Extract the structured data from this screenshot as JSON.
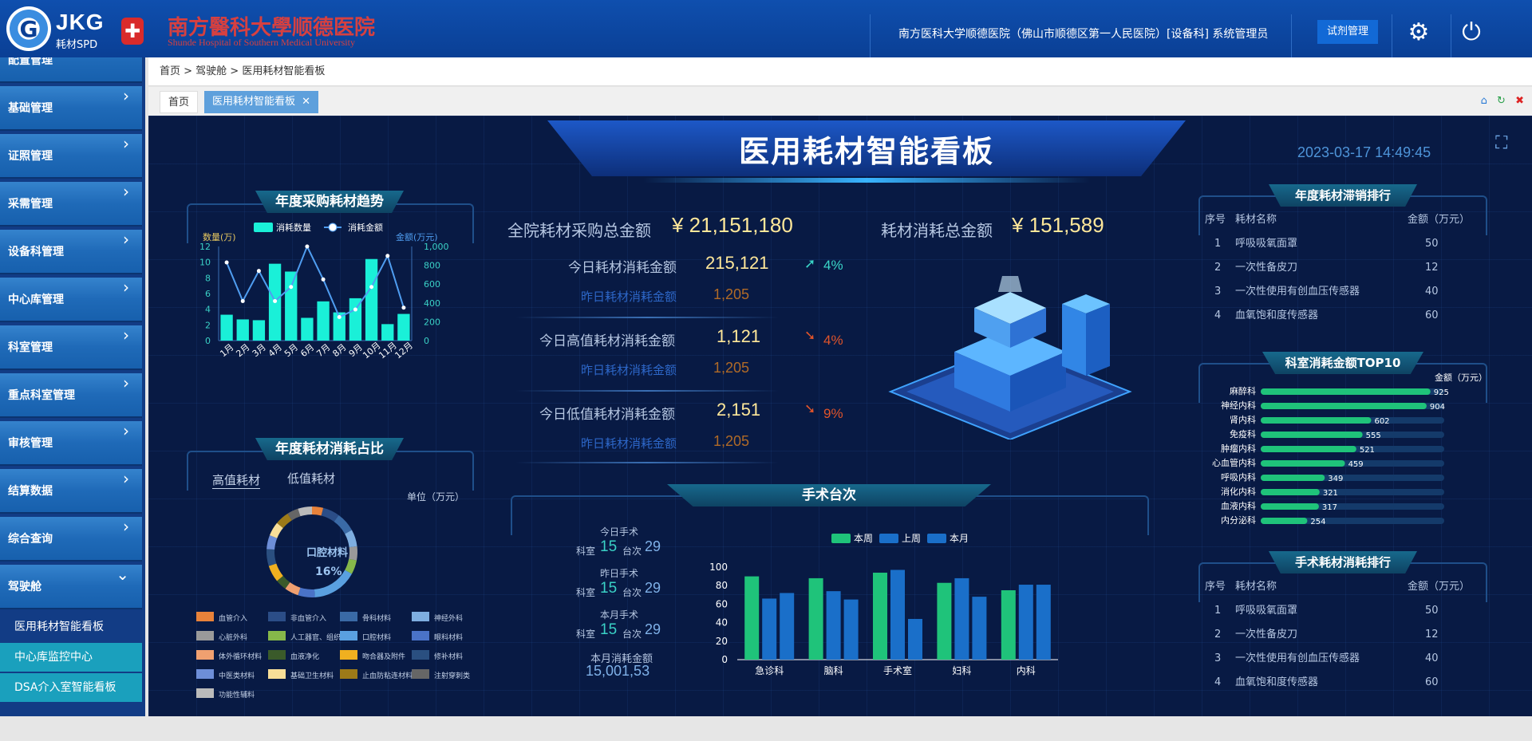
{
  "header": {
    "logo_letter": "G",
    "logo_title": "JKG",
    "logo_sub": "耗材SPD",
    "hospital_badge": "✚",
    "hospital_name": "南方醫科大學顺德医院",
    "hospital_en": "Shunde Hospital of Southern Medical University",
    "user_info": "南方医科大学顺德医院（佛山市顺德区第一人民医院）[设备科]  系统管理员",
    "role_button": "试剂管理",
    "settings_icon": "⚙",
    "power_icon": "⏻"
  },
  "sidebar": {
    "items": [
      {
        "label": "配置管理",
        "chev": "›"
      },
      {
        "label": "基础管理",
        "chev": "›"
      },
      {
        "label": "证照管理",
        "chev": "›"
      },
      {
        "label": "采需管理",
        "chev": "›"
      },
      {
        "label": "设备科管理",
        "chev": "›"
      },
      {
        "label": "中心库管理",
        "chev": "›"
      },
      {
        "label": "科室管理",
        "chev": "›"
      },
      {
        "label": "重点科室管理",
        "chev": "›"
      },
      {
        "label": "审核管理",
        "chev": "›"
      },
      {
        "label": "结算数据",
        "chev": "›"
      },
      {
        "label": "综合查询",
        "chev": "›"
      },
      {
        "label": "驾驶舱",
        "chev": "⌄"
      }
    ],
    "sub_items": [
      {
        "label": "医用耗材智能看板"
      },
      {
        "label": "中心库监控中心"
      },
      {
        "label": "DSA介入室智能看板"
      }
    ]
  },
  "breadcrumb": {
    "text": "首页 > 驾驶舱 > 医用耗材智能看板"
  },
  "tabs": {
    "home": "首页",
    "current": "医用耗材智能看板",
    "close": "✕",
    "tool_home": "⌂",
    "tool_refresh": "↻",
    "tool_close": "✖"
  },
  "dashboard": {
    "title": "医用耗材智能看板",
    "datetime": "2023-03-17  14:49:45",
    "expand_icon": "⛶",
    "kpi": {
      "total_purchase_label": "全院耗材采购总金额",
      "total_purchase_value": "¥ 21,151,180",
      "total_consume_label": "耗材消耗总金额",
      "total_consume_value": "¥ 151,589"
    },
    "rows": [
      {
        "label": "今日耗材消耗金额",
        "value": "215,121",
        "arrow": "➚",
        "pct": "4%",
        "yst_label": "昨日耗材消耗金额",
        "yst_value": "1,205"
      },
      {
        "label": "今日高值耗材消耗金额",
        "value": "1,121",
        "arrow": "➘",
        "pct": "4%",
        "yst_label": "昨日耗材消耗金额",
        "yst_value": "1,205"
      },
      {
        "label": "今日低值耗材消耗金额",
        "value": "2,151",
        "arrow": "➘",
        "pct": "9%",
        "yst_label": "昨日耗材消耗金额",
        "yst_value": "1,205"
      }
    ],
    "panels": {
      "annual_trend": "年度采购耗材趋势",
      "annual_share": "年度耗材消耗占比",
      "stagnant_rank": "年度耗材滞销排行",
      "dept_top10": "科室消耗金额TOP10",
      "surgery_count": "手术台次",
      "surgery_rank": "手术耗材消耗排行"
    },
    "share": {
      "tab_high": "高值耗材",
      "tab_low": "低值耗材",
      "unit": "单位（万元）",
      "center_name": "口腔材料",
      "center_pct": "16%"
    },
    "tables": {
      "header": {
        "no": "序号",
        "name": "耗材名称",
        "amount": "金额（万元）"
      },
      "stagnant": [
        {
          "no": "1",
          "name": "呼吸吸氧面罩",
          "amount": "50"
        },
        {
          "no": "2",
          "name": "一次性备皮刀",
          "amount": "12"
        },
        {
          "no": "3",
          "name": "一次性使用有创血压传感器",
          "amount": "40"
        },
        {
          "no": "4",
          "name": "血氧饱和度传感器",
          "amount": "60"
        }
      ],
      "surgery": [
        {
          "no": "1",
          "name": "呼吸吸氧面罩",
          "amount": "50"
        },
        {
          "no": "2",
          "name": "一次性备皮刀",
          "amount": "12"
        },
        {
          "no": "3",
          "name": "一次性使用有创血压传感器",
          "amount": "40"
        },
        {
          "no": "4",
          "name": "血氧饱和度传感器",
          "amount": "60"
        }
      ]
    },
    "surgery_stats": [
      {
        "title": "今日手术",
        "k1": "科室",
        "v1": "15",
        "k2": "台次",
        "v2": "29"
      },
      {
        "title": "昨日手术",
        "k1": "科室",
        "v1": "15",
        "k2": "台次",
        "v2": "29"
      },
      {
        "title": "本月手术",
        "k1": "科室",
        "v1": "15",
        "k2": "台次",
        "v2": "29"
      }
    ],
    "month_amount": {
      "label": "本月消耗金额",
      "value": "15,001,53"
    }
  },
  "chart_data": [
    {
      "type": "bar",
      "chart": "annual_trend",
      "categories": [
        "1月",
        "2月",
        "3月",
        "4月",
        "5月",
        "6月",
        "7月",
        "8月",
        "9月",
        "10月",
        "11月",
        "12月"
      ],
      "series": [
        {
          "name": "消耗数量",
          "values": [
            3.3,
            2.7,
            2.6,
            9.8,
            8.8,
            2.9,
            5,
            3.6,
            5.4,
            10.4,
            2.1,
            3.4
          ],
          "color": "#1af0d8",
          "axis": "left"
        },
        {
          "name": "消耗金额",
          "type": "line",
          "values": [
            830,
            420,
            740,
            420,
            570,
            1000,
            650,
            250,
            330,
            570,
            900,
            350
          ],
          "color": "#4f9df0",
          "axis": "right"
        }
      ],
      "ylabel": "数量(万)",
      "ylabel2": "金额(万元)",
      "ylim": [
        0,
        12
      ],
      "y2lim": [
        0,
        1000
      ],
      "yticks": [
        "0",
        "2",
        "4",
        "6",
        "8",
        "10",
        "12"
      ],
      "y2ticks": [
        "0",
        "200",
        "400",
        "600",
        "800",
        "1,000"
      ]
    },
    {
      "type": "pie",
      "chart": "annual_share",
      "slices": [
        {
          "name": "血管介入",
          "value": 4,
          "color": "#e8823a"
        },
        {
          "name": "非血管介入",
          "value": 6,
          "color": "#2b4d87"
        },
        {
          "name": "骨科材料",
          "value": 7,
          "color": "#3a6aa6"
        },
        {
          "name": "神经外科",
          "value": 6,
          "color": "#7eaee0"
        },
        {
          "name": "心脏外科",
          "value": 5,
          "color": "#9a9a9a"
        },
        {
          "name": "人工器官、组织材料",
          "value": 5,
          "color": "#86b84a"
        },
        {
          "name": "口腔材料",
          "value": 16,
          "color": "#5aa0e0"
        },
        {
          "name": "眼科材料",
          "value": 6,
          "color": "#4a73c8"
        },
        {
          "name": "体外循环材料",
          "value": 5,
          "color": "#f0a070"
        },
        {
          "name": "血液净化",
          "value": 4,
          "color": "#3a5a2a"
        },
        {
          "name": "吻合器及附件",
          "value": 6,
          "color": "#f0b020"
        },
        {
          "name": "修补材料",
          "value": 6,
          "color": "#2a4f80"
        },
        {
          "name": "中医类材料",
          "value": 5,
          "color": "#6d8ed8"
        },
        {
          "name": "基础卫生材料",
          "value": 5,
          "color": "#f8de98"
        },
        {
          "name": "止血防粘连材料",
          "value": 5,
          "color": "#9c7a18"
        },
        {
          "name": "注射穿刺类",
          "value": 4,
          "color": "#666666"
        },
        {
          "name": "功能性辅料",
          "value": 5,
          "color": "#bbbbbb"
        }
      ]
    },
    {
      "type": "bar",
      "chart": "dept_top10",
      "orientation": "horizontal",
      "xlabel": "金额（万元）",
      "categories": [
        "麻醉科",
        "神经内科",
        "肾内科",
        "免疫科",
        "肿瘤内科",
        "心血管内科",
        "呼吸内科",
        "消化内科",
        "血液内科",
        "内分泌科"
      ],
      "values": [
        925,
        904,
        602,
        555,
        521,
        459,
        349,
        321,
        317,
        254
      ],
      "xlim": [
        0,
        1000
      ]
    },
    {
      "type": "bar",
      "chart": "surgery_count",
      "categories": [
        "急诊科",
        "脑科",
        "手术室",
        "妇科",
        "内科"
      ],
      "series": [
        {
          "name": "本周",
          "values": [
            90,
            88,
            94,
            83,
            75
          ],
          "color": "#1fc37a"
        },
        {
          "name": "上周",
          "values": [
            66,
            74,
            97,
            88,
            81
          ],
          "color": "#1a6fc9"
        },
        {
          "name": "本月",
          "values": [
            72,
            65,
            44,
            68,
            81
          ],
          "color": "#1a6fc9"
        }
      ],
      "ylim": [
        0,
        100
      ],
      "yticks": [
        "0",
        "20",
        "40",
        "60",
        "80",
        "100"
      ]
    }
  ]
}
